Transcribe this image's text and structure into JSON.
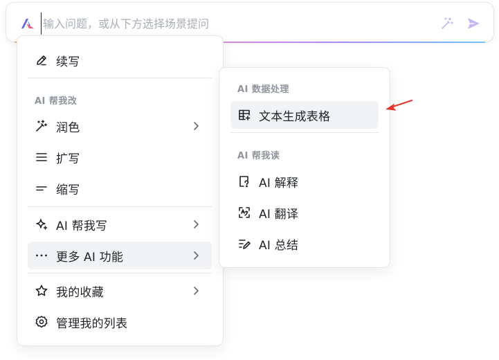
{
  "ai_bar": {
    "placeholder": "输入问题，或从下方选择场景提问"
  },
  "main_menu": {
    "continue_write": "续写",
    "section_ai_edit": "AI 帮我改",
    "polish": "润色",
    "expand": "扩写",
    "shorten": "缩写",
    "ai_write": "AI 帮我写",
    "more_ai": "更多 AI 功能",
    "favorites": "我的收藏",
    "manage_list": "管理我的列表"
  },
  "sub_menu": {
    "section_data": "AI 数据处理",
    "text_to_table": "文本生成表格",
    "section_read": "AI 帮我读",
    "explain": "AI 解释",
    "translate": "AI 翻译",
    "summarize": "AI 总结"
  },
  "colors": {
    "accent_arrow": "#e8362f",
    "active_bg": "#f2f3f5",
    "send_icon": "#c6b6f7"
  },
  "icons": [
    "ai-logo-icon",
    "magic-wand-icon",
    "send-icon",
    "pen-icon",
    "wand-sparkle-icon",
    "lines-icon",
    "short-line-icon",
    "sparkle-star-icon",
    "more-dots-icon",
    "star-icon",
    "gear-icon",
    "chevron-right-icon",
    "table-sparkle-icon",
    "doc-question-icon",
    "translate-icon",
    "summary-icon"
  ]
}
